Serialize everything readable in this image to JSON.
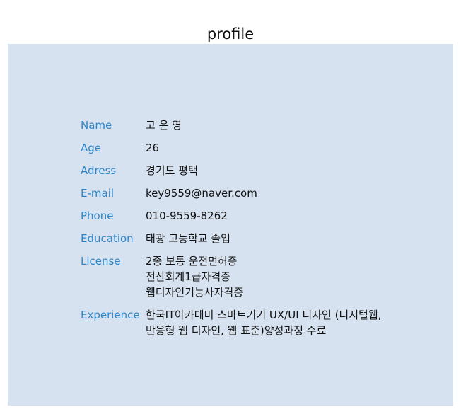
{
  "page": {
    "title": "profile"
  },
  "colors": {
    "panel_background": "#d6e2f0",
    "label_text": "#2e86c9",
    "value_text": "#111111"
  },
  "profile": {
    "rows": [
      {
        "label": "Name",
        "lines": [
          "고 은 영"
        ]
      },
      {
        "label": "Age",
        "lines": [
          "26"
        ]
      },
      {
        "label": "Adress",
        "lines": [
          "경기도 평택"
        ]
      },
      {
        "label": "E-mail",
        "lines": [
          "key9559@naver.com"
        ]
      },
      {
        "label": "Phone",
        "lines": [
          "010-9559-8262"
        ]
      },
      {
        "label": "Education",
        "lines": [
          "태광 고등학교 졸업"
        ]
      },
      {
        "label": "License",
        "lines": [
          "2종 보통 운전면허증",
          "전산회계1급자격증",
          "웹디자인기능사자격증"
        ]
      },
      {
        "label": "Experience",
        "lines": [
          "한국IT아카데미 스마트기기 UX/UI 디자인 (디지털웹,",
          "반응형 웹 디자인, 웹 표준)양성과정 수료"
        ]
      }
    ]
  }
}
